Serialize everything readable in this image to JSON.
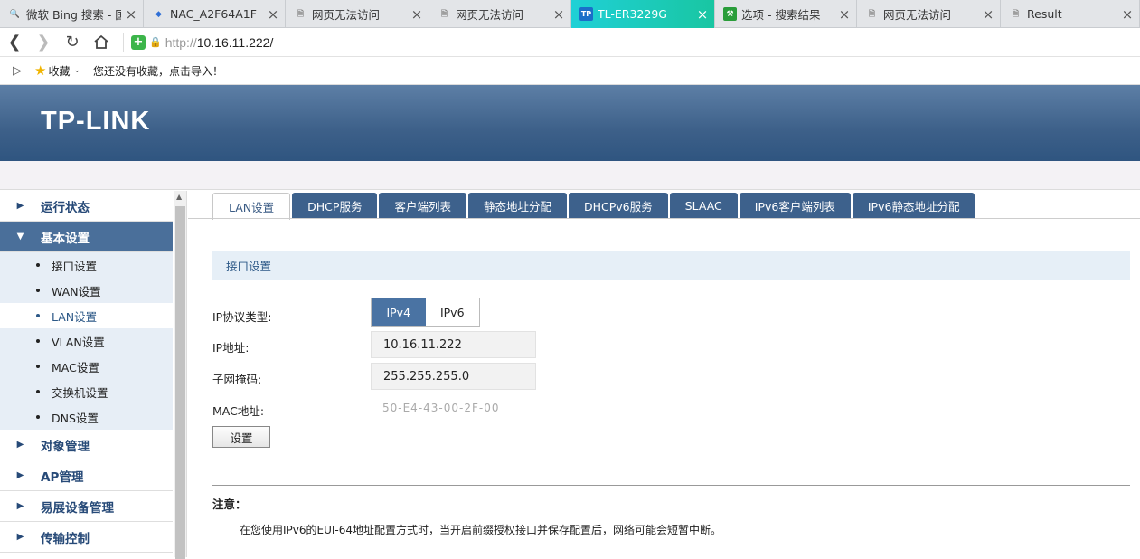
{
  "browser": {
    "tabs": [
      {
        "title": "微软 Bing 搜索 - 国",
        "icon": "search-icon",
        "width": 159,
        "active": false
      },
      {
        "title": "NAC_A2F64A1F",
        "icon": "shield-icon",
        "width": 157,
        "active": false
      },
      {
        "title": "网页无法访问",
        "icon": "page-icon",
        "width": 159,
        "active": false
      },
      {
        "title": "网页无法访问",
        "icon": "page-icon",
        "width": 157,
        "active": false
      },
      {
        "title": "TL-ER3229G",
        "icon": "tplink-icon",
        "width": 159,
        "active": true
      },
      {
        "title": "选项 - 搜索结果",
        "icon": "wrench-icon",
        "width": 157,
        "active": false
      },
      {
        "title": "网页无法访问",
        "icon": "page-icon",
        "width": 159,
        "active": false
      },
      {
        "title": "Result",
        "icon": "page-icon",
        "width": 154,
        "active": false
      }
    ],
    "url_prefix": "http://",
    "url_host": "10.16.11.222/",
    "bookmarks_label": "收藏",
    "bookmarks_hint": "您还没有收藏，点击导入！"
  },
  "header": {
    "logo": "TP-LINK"
  },
  "sidebar": {
    "menu": [
      {
        "label": "运行状态",
        "open": false
      },
      {
        "label": "基本设置",
        "open": true
      },
      {
        "label": "对象管理",
        "open": false
      },
      {
        "label": "AP管理",
        "open": false
      },
      {
        "label": "易展设备管理",
        "open": false
      },
      {
        "label": "传输控制",
        "open": false
      }
    ],
    "submenu": [
      "接口设置",
      "WAN设置",
      "LAN设置",
      "VLAN设置",
      "MAC设置",
      "交换机设置",
      "DNS设置"
    ],
    "current_submenu": "LAN设置"
  },
  "page_tabs": [
    "LAN设置",
    "DHCP服务",
    "客户端列表",
    "静态地址分配",
    "DHCPv6服务",
    "SLAAC",
    "IPv6客户端列表",
    "IPv6静态地址分配"
  ],
  "section_title": "接口设置",
  "form": {
    "ip_type_label": "IP协议类型:",
    "ip_type_options": [
      "IPv4",
      "IPv6"
    ],
    "ip_type_selected": "IPv4",
    "ip_label": "IP地址:",
    "ip_value": "10.16.11.222",
    "mask_label": "子网掩码:",
    "mask_value": "255.255.255.0",
    "mac_label": "MAC地址:",
    "mac_value": "50-E4-43-00-2F-00",
    "submit_label": "设置"
  },
  "note": {
    "title": "注意：",
    "text": "在您使用IPv6的EUI-64地址配置方式时，当开启前缀授权接口并保存配置后，网络可能会短暂中断。"
  },
  "colors": {
    "header_blue": "#3d6089",
    "tab_active": "#1fd0d6",
    "menu_open": "#4a6f9a"
  }
}
